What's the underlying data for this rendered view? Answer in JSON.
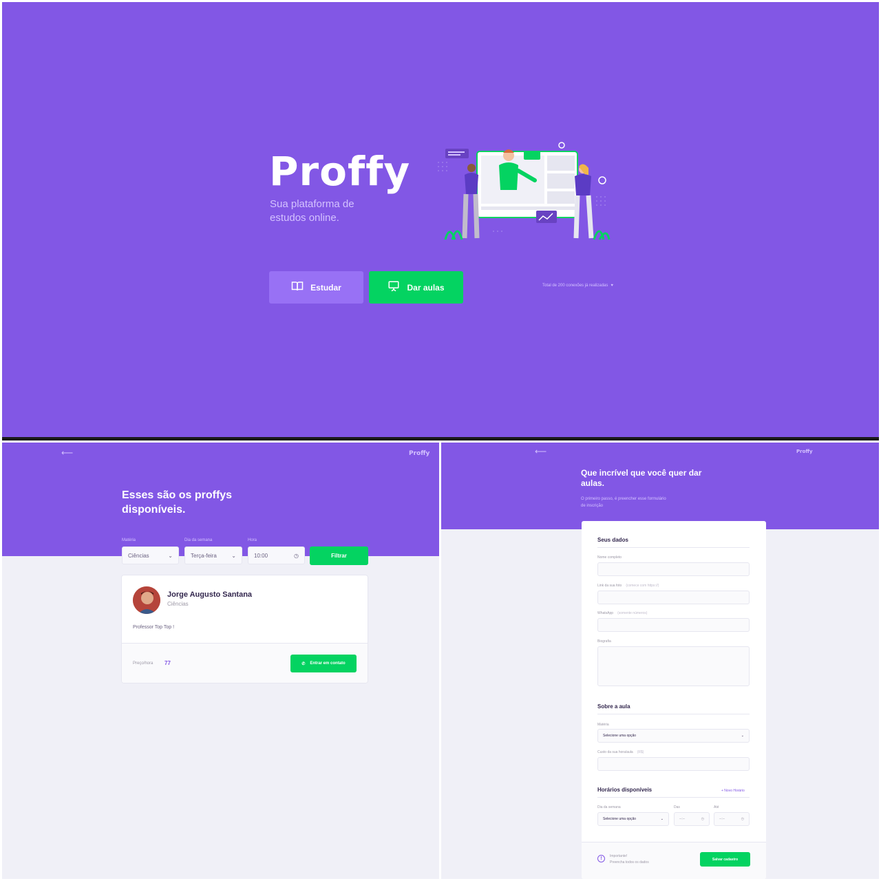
{
  "landing": {
    "logo": "Proffy",
    "tagline": "Sua plataforma de estudos online.",
    "study_button": "Estudar",
    "teach_button": "Dar aulas",
    "connections": "Total de 200 conexões já realizadas"
  },
  "list_page": {
    "back_arrow": "⟵",
    "logo": "Proffy",
    "title": "Esses são os proffys disponíveis.",
    "filters": {
      "subject_label": "Matéria",
      "subject_value": "Ciências",
      "weekday_label": "Dia da semana",
      "weekday_value": "Terça-feira",
      "time_label": "Hora",
      "time_value": "10:00",
      "filter_button": "Filtrar"
    },
    "teacher": {
      "name": "Jorge Augusto Santana",
      "subject": "Ciências",
      "bio": "Professor Top Top !",
      "price_label": "Preço/hora",
      "price_value": "77",
      "contact_button": "Entrar em contato"
    }
  },
  "form_page": {
    "back_arrow": "⟵",
    "logo": "Proffy",
    "title": "Que incrível que você quer dar aulas.",
    "subtitle": "O primeiro passo, é preencher esse formulário de inscrição",
    "section_data": "Seus dados",
    "name_label": "Nome completo",
    "avatar_label": "Link da sua foto",
    "avatar_hint": "(comece com https://)",
    "whatsapp_label": "WhatsApp",
    "whatsapp_hint": "(somente números)",
    "bio_label": "Biografia",
    "section_class": "Sobre a aula",
    "subject_label": "Matéria",
    "subject_placeholder": "Selecione uma opção",
    "cost_label": "Custo da sua hora/aula",
    "cost_hint": "(R$)",
    "section_schedule": "Horários disponíveis",
    "new_time": "+ Novo Horário",
    "weekday_label": "Dia da semana",
    "weekday_placeholder": "Selecione uma opção",
    "from_label": "Das",
    "to_label": "Até",
    "time_placeholder": "--:--",
    "warning_title": "Importante!",
    "warning_text": "Preencha todos os dados",
    "save_button": "Salvar cadastro"
  },
  "colors": {
    "primary": "#8257e5",
    "primary_lighter": "#9871f5",
    "secondary": "#04d361",
    "background": "#f0f0f7",
    "text_title": "#32264d"
  },
  "icons": [
    "book-open-icon",
    "presentation-icon",
    "purple-heart-icon",
    "whatsapp-icon",
    "clock-icon",
    "chevron-down-icon",
    "warning-icon",
    "back-arrow-icon"
  ]
}
